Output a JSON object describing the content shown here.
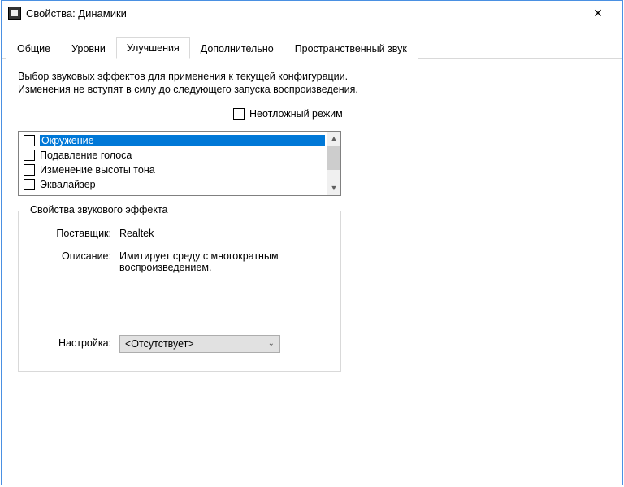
{
  "titlebar": {
    "title": "Свойства: Динамики"
  },
  "tabs": {
    "general": "Общие",
    "levels": "Уровни",
    "enhancements": "Улучшения",
    "advanced": "Дополнительно",
    "spatial": "Пространственный звук"
  },
  "main": {
    "instruction": "Выбор звуковых эффектов для применения к текущей конфигурации. Изменения не вступят в силу до следующего запуска воспроизведения.",
    "immediate_mode_label": "Неотложный режим",
    "effects": [
      "Окружение",
      "Подавление голоса",
      "Изменение высоты тона",
      "Эквалайзер"
    ]
  },
  "group": {
    "title": "Свойства звукового эффекта",
    "vendor_label": "Поставщик:",
    "vendor_value": "Realtek",
    "description_label": "Описание:",
    "description_value": "Имитирует среду с многократным воспроизведением.",
    "setting_label": "Настройка:",
    "setting_value": "<Отсутствует>"
  }
}
